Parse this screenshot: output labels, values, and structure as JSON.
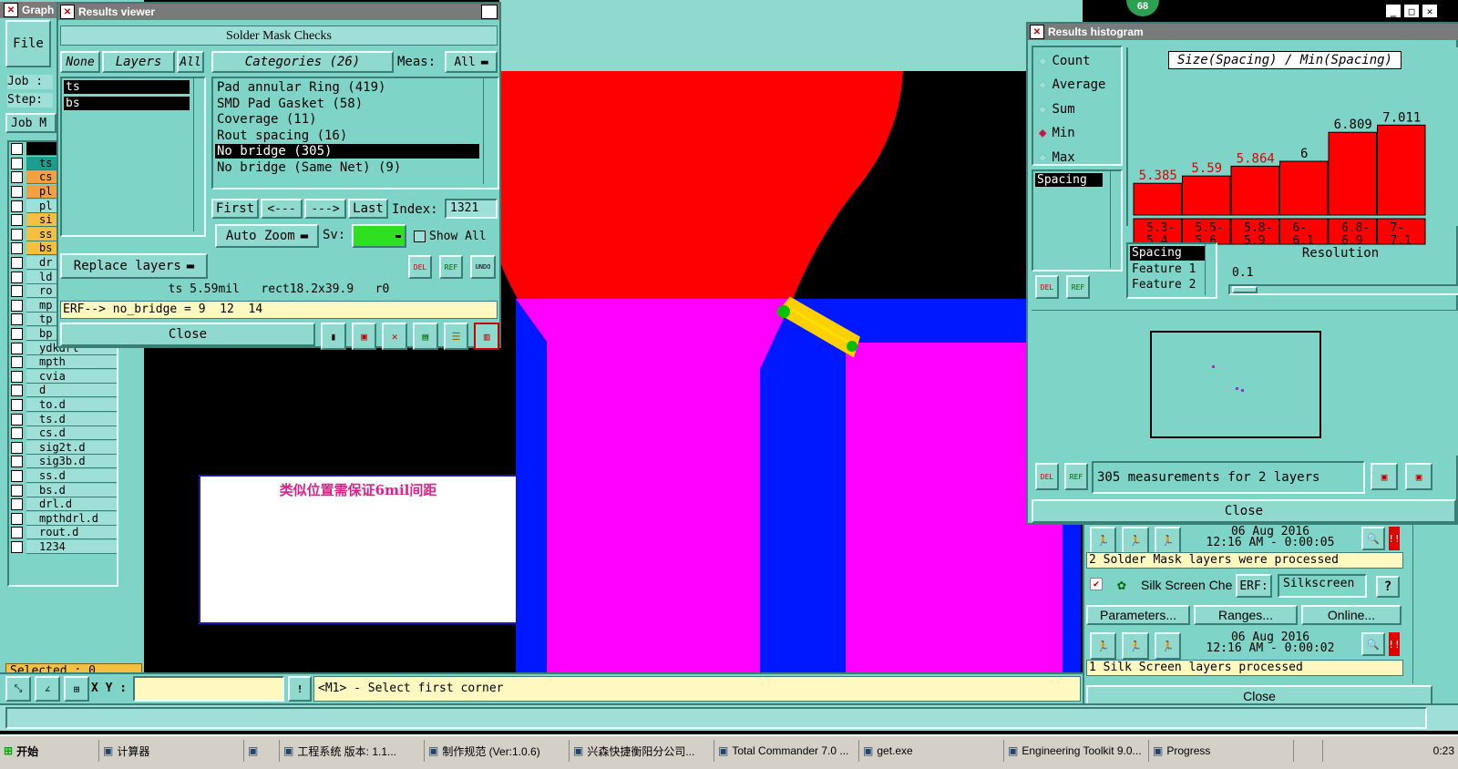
{
  "results_viewer": {
    "title": "Results viewer",
    "heading": "Solder Mask Checks",
    "layer_tabs": [
      "None",
      "Layers",
      "All"
    ],
    "layers": [
      "ts",
      "bs"
    ],
    "categories_header": "Categories (26)",
    "meas_label": "Meas:",
    "meas_value": "All",
    "categories": [
      {
        "label": "Pad annular Ring (419)",
        "selected": false
      },
      {
        "label": "SMD Pad Gasket (58)",
        "selected": false
      },
      {
        "label": "Coverage (11)",
        "selected": false
      },
      {
        "label": "Rout spacing (16)",
        "selected": false
      },
      {
        "label": "No bridge (305)",
        "selected": true
      },
      {
        "label": "No bridge (Same Net) (9)",
        "selected": false
      }
    ],
    "nav": {
      "first": "First",
      "prev": "<---",
      "next": "--->",
      "last": "Last",
      "index_label": "Index:",
      "index_value": "1321"
    },
    "auto_zoom": "Auto Zoom",
    "sv_label": "Sv:",
    "show_all": "Show All",
    "replace_layers": "Replace layers",
    "icons": {
      "del": "DEL",
      "ref": "REF",
      "undo": "UNDO"
    },
    "status_line": "ts 5.59mil   rect18.2x39.9   r0",
    "erf_line": "ERF--> no_bridge = 9  12  14",
    "close": "Close"
  },
  "graphic_editor": {
    "title": "Graph",
    "file_menu": "File",
    "job_label": "Job :",
    "step_label": "Step:",
    "job_button": "Job M",
    "layers": [
      {
        "name": "to",
        "color": "#000000"
      },
      {
        "name": "ts",
        "color": "#1a9e8e"
      },
      {
        "name": "cs",
        "color": "#f4a040"
      },
      {
        "name": "pl",
        "color": "#f4a040"
      },
      {
        "name": "pl",
        "color": "#9ee0d8"
      },
      {
        "name": "si",
        "color": "#f4c040"
      },
      {
        "name": "ss",
        "color": "#f4c040"
      },
      {
        "name": "bs",
        "color": "#f4c040"
      },
      {
        "name": "dr",
        "color": "#9ee0d8"
      },
      {
        "name": "ld",
        "color": "#9ee0d8"
      },
      {
        "name": "ro",
        "color": "#9ee0d8"
      },
      {
        "name": "mp",
        "color": "#9ee0d8"
      },
      {
        "name": "tp",
        "color": "#9ee0d8"
      },
      {
        "name": "bp",
        "color": "#9ee0d8"
      },
      {
        "name": "ydkdrl",
        "color": "#9ee0d8"
      },
      {
        "name": "mpth",
        "color": "#9ee0d8"
      },
      {
        "name": "cvia",
        "color": "#9ee0d8"
      },
      {
        "name": "d",
        "color": "#9ee0d8"
      },
      {
        "name": "to.d",
        "color": "#9ee0d8"
      },
      {
        "name": "ts.d",
        "color": "#9ee0d8"
      },
      {
        "name": "cs.d",
        "color": "#9ee0d8"
      },
      {
        "name": "sig2t.d",
        "color": "#9ee0d8"
      },
      {
        "name": "sig3b.d",
        "color": "#9ee0d8"
      },
      {
        "name": "ss.d",
        "color": "#9ee0d8"
      },
      {
        "name": "bs.d",
        "color": "#9ee0d8"
      },
      {
        "name": "drl.d",
        "color": "#9ee0d8"
      },
      {
        "name": "mpthdrl.d",
        "color": "#9ee0d8"
      },
      {
        "name": "rout.d",
        "color": "#9ee0d8"
      },
      {
        "name": "1234",
        "color": "#9ee0d8"
      }
    ],
    "selected_label": "Selected : 0",
    "xy_label": "X Y :",
    "prompt": "<M1> - Select first corner",
    "annotation": "类似位置需保证6mil间距",
    "badge": "68"
  },
  "histogram": {
    "title": "Results histogram",
    "modes": [
      {
        "label": "Count",
        "selected": false
      },
      {
        "label": "Average",
        "selected": false
      },
      {
        "label": "Sum",
        "selected": false
      },
      {
        "label": "Min",
        "selected": true
      },
      {
        "label": "Max",
        "selected": false
      }
    ],
    "metric": "Spacing",
    "chart_title": "Size(Spacing) / Min(Spacing)",
    "features": [
      "Spacing",
      "Feature 1",
      "Feature 2"
    ],
    "resolution_label": "Resolution",
    "resolution_value": "0.1",
    "summary": "305 measurements for 2 layers",
    "close": "Close"
  },
  "chart_data": {
    "type": "bar",
    "title": "Size(Spacing) / Min(Spacing)",
    "categories": [
      "5.3-5.4",
      "5.5-5.6",
      "5.8-5.9",
      "6-6.1",
      "6.8-6.9",
      "7-7.1"
    ],
    "category_labels": [
      [
        "5.3-",
        "5.4"
      ],
      [
        "5.5-",
        "5.6"
      ],
      [
        "5.8-",
        "5.9"
      ],
      [
        "6-",
        "6.1"
      ],
      [
        "6.8-",
        "6.9"
      ],
      [
        "7-",
        "7.1"
      ]
    ],
    "values": [
      5.385,
      5.59,
      5.864,
      6,
      6.809,
      7.011
    ],
    "value_labels": [
      "5.385",
      "5.59",
      "5.864",
      "6",
      "6.809",
      "7.011"
    ],
    "value_label_colors": [
      "#e00000",
      "#e00000",
      "#e00000",
      "#000000",
      "#000000",
      "#000000"
    ],
    "bar_color": "#ff0000",
    "ylim": [
      4.5,
      7.4
    ]
  },
  "checklist": {
    "run1_date": "06 Aug 2016",
    "run1_time": "12:16 AM - 0:00:05",
    "run1_status": "2 Solder Mask layers were processed",
    "silk_label": "Silk Screen Che",
    "erf_label": "ERF:",
    "erf_value": "Silkscreen",
    "help": "?",
    "parameters": "Parameters...",
    "ranges": "Ranges...",
    "online": "Online...",
    "run2_date": "06 Aug 2016",
    "run2_time": "12:16 AM - 0:00:02",
    "run2_status": "1 Silk Screen layers processed",
    "close": "Close"
  },
  "taskbar": {
    "start": "开始",
    "items": [
      "计算器",
      "",
      "工程系统  版本: 1.1...",
      "制作规范 (Ver:1.0.6)",
      "兴森快捷衡阳分公司...",
      "Total Commander 7.0 ...",
      "get.exe",
      "Engineering Toolkit 9.0...",
      "Progress"
    ],
    "clock": "0:23"
  }
}
